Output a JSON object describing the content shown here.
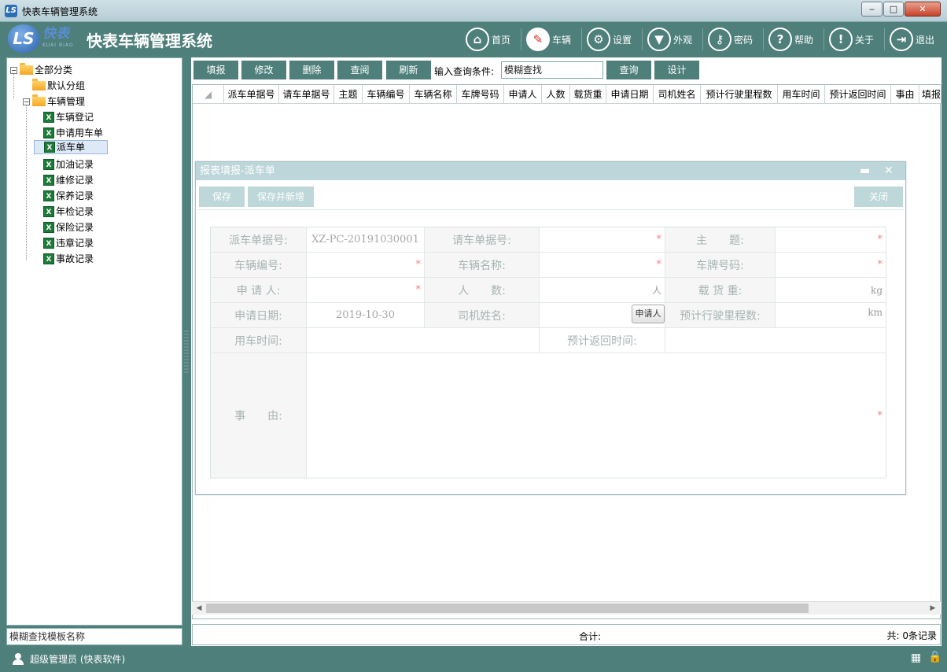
{
  "window": {
    "title": "快表车辆管理系统"
  },
  "header": {
    "logo_text": "快表",
    "logo_sub": "KUAI BIAO",
    "app_title": "快表车辆管理系统",
    "nav": [
      {
        "label": "首页",
        "icon": "home-icon"
      },
      {
        "label": "车辆",
        "icon": "car-doc-icon"
      },
      {
        "label": "设置",
        "icon": "gear-icon"
      },
      {
        "label": "外观",
        "icon": "shirt-icon"
      },
      {
        "label": "密码",
        "icon": "key-icon"
      },
      {
        "label": "帮助",
        "icon": "help-icon"
      },
      {
        "label": "关于",
        "icon": "info-icon"
      },
      {
        "label": "退出",
        "icon": "exit-icon"
      }
    ]
  },
  "tree": {
    "root": "全部分类",
    "default_group": "默认分组",
    "vehicle_mgmt": "车辆管理",
    "items": [
      "车辆登记",
      "申请用车单",
      "派车单",
      "加油记录",
      "维修记录",
      "保养记录",
      "年检记录",
      "保险记录",
      "违章记录",
      "事故记录"
    ],
    "selected": "派车单"
  },
  "left_search": {
    "placeholder": "模糊查找模板名称"
  },
  "toolbar": {
    "buttons": [
      "填报",
      "修改",
      "删除",
      "查阅",
      "刷新"
    ],
    "query_label": "输入查询条件:",
    "query_value": "模糊查找",
    "search_btn": "查询",
    "design_btn": "设计"
  },
  "grid": {
    "columns": [
      "派车单据号",
      "请车单据号",
      "主题",
      "车辆编号",
      "车辆名称",
      "车牌号码",
      "申请人",
      "人数",
      "载货重",
      "申请日期",
      "司机姓名",
      "预计行驶里程数",
      "用车时间",
      "预计返回时间",
      "事由",
      "填报"
    ]
  },
  "footer": {
    "sum_label": "合计:",
    "count_text": "共: 0条记录"
  },
  "status": {
    "user": "超级管理员 (快表软件)"
  },
  "dialog": {
    "title": "报表填报-派车单",
    "save": "保存",
    "save_new": "保存并新增",
    "close": "关闭",
    "labels": {
      "dispatch_no": "派车单据号:",
      "request_no": "请车单据号:",
      "subject": "主　　题:",
      "vehicle_no": "车辆编号:",
      "vehicle_name": "车辆名称:",
      "plate": "车牌号码:",
      "applicant": "申 请 人:",
      "people": "人　　数:",
      "load": "载 货 重:",
      "apply_date": "申请日期:",
      "driver": "司机姓名:",
      "mileage": "预计行驶里程数:",
      "use_time": "用车时间:",
      "return_time": "预计返回时间:",
      "reason": "事　　由:"
    },
    "values": {
      "dispatch_no": "XZ-PC-20191030001",
      "apply_date": "2019-10-30",
      "people_unit": "人",
      "load_unit": "kg",
      "mileage_unit": "km",
      "applicant_btn": "申请人",
      "required_mark": "*"
    }
  }
}
